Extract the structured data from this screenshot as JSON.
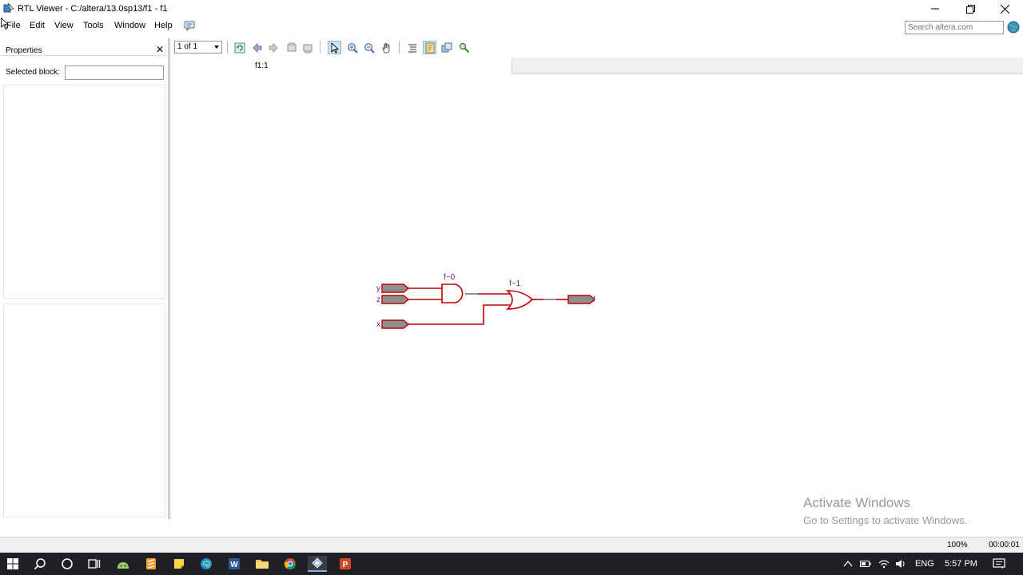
{
  "window": {
    "title": "RTL Viewer - C:/altera/13.0sp13/f1 - f1"
  },
  "menu": {
    "items": [
      "File",
      "Edit",
      "View",
      "Tools",
      "Window",
      "Help"
    ]
  },
  "search": {
    "placeholder": "Search altera.com"
  },
  "properties": {
    "title": "Properties",
    "selected_block_label": "Selected block:",
    "selected_block_value": ""
  },
  "toolbar": {
    "page_select": "1 of 1",
    "buttons": [
      "refresh-icon",
      "back-icon",
      "forward-icon",
      "go-up-icon",
      "go-down-icon",
      "select-icon",
      "zoom-in-icon",
      "zoom-out-icon",
      "hand-icon",
      "netlist-navigator-icon",
      "filter-icon",
      "hierarchy-icon",
      "find-icon"
    ]
  },
  "canvas": {
    "hierarchy_label": "f1:1"
  },
  "schematic": {
    "inputs": [
      "y",
      "z",
      "x"
    ],
    "output": "f",
    "gates": [
      {
        "type": "AND",
        "label": "f~0"
      },
      {
        "type": "OR",
        "label": "f~1"
      }
    ],
    "wire_color": "#c00000"
  },
  "watermark": {
    "line1": "Activate Windows",
    "line2": "Go to Settings to activate Windows."
  },
  "status": {
    "zoom": "100%",
    "elapsed": "00:00:01"
  },
  "taskbar": {
    "lang": "ENG",
    "clock": "5:57 PM"
  },
  "colors": {
    "accent": "#7ab4e8",
    "taskbar": "#1f1f26",
    "gate_stroke": "#c00000",
    "port_fill": "#8f8f8f",
    "label_purple": "#7a1a8a"
  }
}
